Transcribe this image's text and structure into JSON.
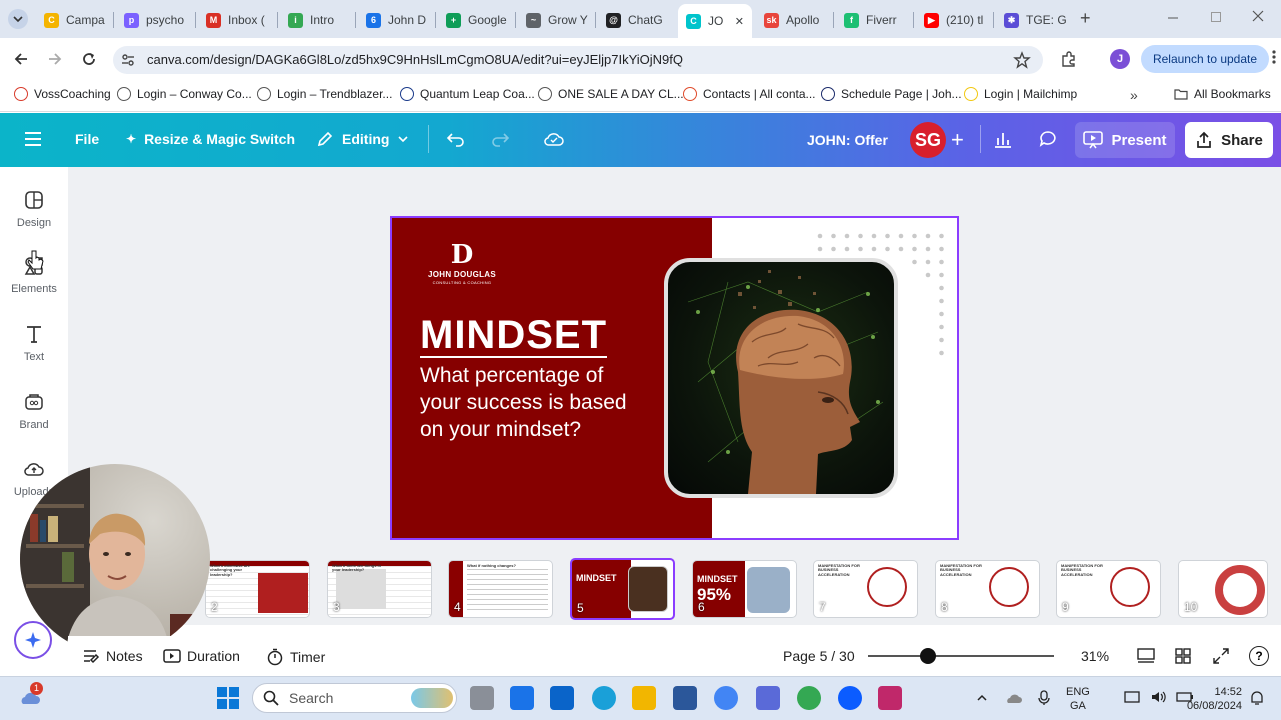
{
  "browser": {
    "tabs": [
      {
        "label": "Campa",
        "color": "#f4b400",
        "glyph": "C"
      },
      {
        "label": "psycho",
        "color": "#7b61ff",
        "glyph": "p"
      },
      {
        "label": "Inbox (",
        "color": "#d93025",
        "glyph": "M"
      },
      {
        "label": "Intro",
        "color": "#34a853",
        "glyph": "i"
      },
      {
        "label": "John D",
        "color": "#1a73e8",
        "glyph": "6"
      },
      {
        "label": "Google",
        "color": "#0f9d58",
        "glyph": "+"
      },
      {
        "label": "Grow Y",
        "color": "#5f6368",
        "glyph": "~"
      },
      {
        "label": "ChatG",
        "color": "#202124",
        "glyph": "@"
      },
      {
        "label": "JO",
        "color": "#00c4cc",
        "glyph": "C"
      },
      {
        "label": "Apollo",
        "color": "#e8453c",
        "glyph": "sk"
      },
      {
        "label": "Fiverr",
        "color": "#1dbf73",
        "glyph": "f"
      },
      {
        "label": "(210) tl",
        "color": "#ff0000",
        "glyph": "▶"
      },
      {
        "label": "TGE: G",
        "color": "#5b4dd6",
        "glyph": "✱"
      }
    ],
    "url": "canva.com/design/DAGKa6Gl8Lo/zd5hx9C9HnHslLmCgmO8UA/edit?ui=eyJEljp7IkYiOjN9fQ",
    "relaunch_label": "Relaunch to update",
    "profile_initial": "J",
    "bookmarks": [
      {
        "label": "VossCoaching"
      },
      {
        "label": "Login – Conway Co..."
      },
      {
        "label": "Login – Trendblazer..."
      },
      {
        "label": "Quantum Leap Coa..."
      },
      {
        "label": "ONE SALE A DAY CL..."
      },
      {
        "label": "Contacts | All conta..."
      },
      {
        "label": "Schedule Page | Joh..."
      },
      {
        "label": "Login | Mailchimp"
      }
    ],
    "all_bookmarks_label": "All Bookmarks"
  },
  "toolbar": {
    "file_label": "File",
    "resize_label": "Resize & Magic Switch",
    "editing_label": "Editing",
    "design_title": "JOHN: Offer",
    "avatar_initials": "SG",
    "present_label": "Present",
    "share_label": "Share"
  },
  "sidebar": {
    "items": [
      {
        "label": "Design"
      },
      {
        "label": "Elements"
      },
      {
        "label": "Text"
      },
      {
        "label": "Brand"
      },
      {
        "label": "Uploads"
      }
    ]
  },
  "slide": {
    "logo_letter": "D",
    "logo_name": "JOHN DOUGLAS",
    "logo_tagline": "CONSULTING & COACHING",
    "heading": "MINDSET",
    "body_line1": "What percentage of",
    "body_line2": "your success is based",
    "body_line3": "on your mindset?",
    "accent_color": "#8b0000"
  },
  "pages": {
    "thumbnails": [
      {
        "num": "2",
        "title": "What's otherwise are challenging your leadership?"
      },
      {
        "num": "3",
        "title": "What if there are things in your leadership?"
      },
      {
        "num": "4",
        "title": "What if nothing changes?"
      },
      {
        "num": "5",
        "title": "MINDSET"
      },
      {
        "num": "6",
        "title": "MINDSET",
        "big": "95%"
      },
      {
        "num": "7",
        "title": "MANIFESTATION FOR BUSINESS ACCELERATION"
      },
      {
        "num": "8",
        "title": "MANIFESTATION FOR BUSINESS ACCELERATION"
      },
      {
        "num": "9",
        "title": "MANIFESTATION FOR BUSINESS ACCELERATION"
      },
      {
        "num": "10",
        "title": ""
      }
    ]
  },
  "footer": {
    "notes_label": "Notes",
    "duration_label": "Duration",
    "timer_label": "Timer",
    "page_indicator": "Page 5 / 30",
    "zoom_label": "31%",
    "zoom_fraction": 0.31
  },
  "taskbar": {
    "search_placeholder": "Search",
    "lang_line1": "ENG",
    "lang_line2": "GA",
    "time": "14:52",
    "date": "06/08/2024",
    "notification_count": "1"
  }
}
